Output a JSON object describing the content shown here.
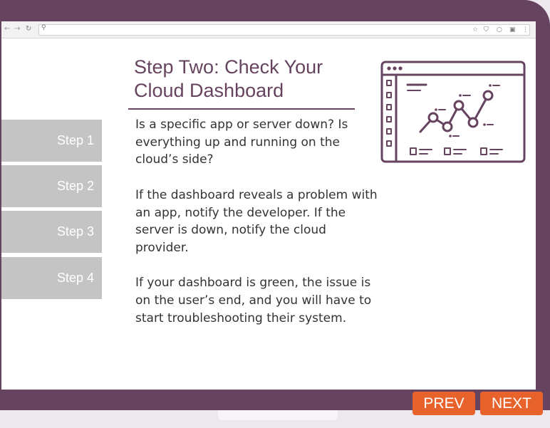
{
  "browser": {
    "back_icon": "back-arrow",
    "forward_icon": "forward-arrow",
    "reload_icon": "reload",
    "url": "",
    "toolbar_icons": [
      "star-icon",
      "shield-icon",
      "circle-icon",
      "square-icon",
      "menu-dots-icon"
    ]
  },
  "steps": [
    {
      "label": "Step 1"
    },
    {
      "label": "Step 2"
    },
    {
      "label": "Step 3"
    },
    {
      "label": "Step 4"
    }
  ],
  "slide": {
    "title_line1": "Step Two: Check Your",
    "title_line2": "Cloud Dashboard",
    "paragraphs": [
      "Is a specific app or server down? Is everything up and running on the cloud’s side?",
      "If the dashboard reveals a problem with an app, notify the developer. If the server is down, notify the cloud provider.",
      "If your dashboard is green, the issue is on the user’s end, and you will have to start troubleshooting their system."
    ],
    "illustration": "dashboard-chart-icon"
  },
  "navigation": {
    "prev_label": "PREV",
    "next_label": "NEXT"
  },
  "colors": {
    "frame": "#66435f",
    "accent": "#e8632b",
    "step_bg": "#c4c4c4",
    "title": "#66435f"
  }
}
